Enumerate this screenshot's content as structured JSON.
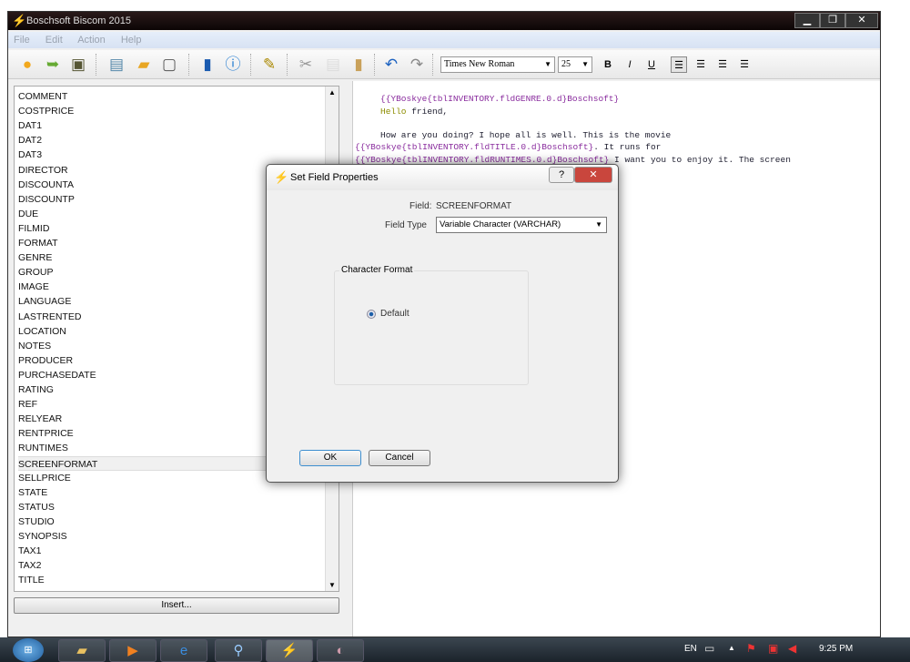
{
  "window": {
    "title": "Boschsoft Biscom 2015",
    "minimize": "▁",
    "maximize": "❐",
    "close": "✕"
  },
  "menu": [
    "File",
    "Edit",
    "Action",
    "Help"
  ],
  "toolbar": {
    "font": "Times New Roman",
    "size": "25",
    "bold": "B",
    "italic": "I",
    "underline": "U",
    "icons": [
      "database-icon",
      "open-folder-icon",
      "save-disk-icon",
      "document-icon",
      "export-folder-icon",
      "save-icon",
      "help-book-icon",
      "info-icon",
      "edit-form-icon",
      "cut-icon",
      "copy-icon",
      "paste-icon",
      "undo-icon",
      "redo-icon"
    ],
    "align_icons": [
      "align-left-icon",
      "align-center-icon",
      "align-right-icon",
      "justify-icon"
    ]
  },
  "fields": [
    "COMMENT",
    "COSTPRICE",
    "DAT1",
    "DAT2",
    "DAT3",
    "DIRECTOR",
    "DISCOUNTA",
    "DISCOUNTP",
    "DUE",
    "FILMID",
    "FORMAT",
    "GENRE",
    "GROUP",
    "IMAGE",
    "LANGUAGE",
    "LASTRENTED",
    "LOCATION",
    "NOTES",
    "PRODUCER",
    "PURCHASEDATE",
    "RATING",
    "REF",
    "RELYEAR",
    "RENTPRICE",
    "RUNTIMES",
    "SCREENFORMAT",
    "SELLPRICE",
    "STATE",
    "STATUS",
    "STUDIO",
    "SYNOPSIS",
    "TAX1",
    "TAX2",
    "TITLE"
  ],
  "selected_field": "SCREENFORMAT",
  "insert_label": "Insert...",
  "editor": {
    "line1": "{{YBoskye{tblINVENTORY.fldGENRE.0.d}Boschsoft}",
    "line2_a": "Hello",
    "line2_b": " friend,",
    "line3": "How are you doing? I hope all is well. This is the movie",
    "line4_a": "{{YBoskye{tblINVENTORY.fldTITLE.0.d}Boschsoft}",
    "line4_b": ". It runs for",
    "line5_a": "{{YBoskye{tblINVENTORY.fldRUNTIMES.0.d}Boschsoft}",
    "line5_b": " I want you to enjoy it. The screen"
  },
  "dialog": {
    "title": "Set Field Properties",
    "help": "?",
    "close": "✕",
    "field_label": "Field:",
    "field_value": "SCREENFORMAT",
    "type_label": "Field Type",
    "type_value": "Variable Character (VARCHAR)",
    "group_label": "Character Format",
    "radio_label": "Default",
    "ok": "OK",
    "cancel": "Cancel"
  },
  "tray": {
    "lang": "EN",
    "time": "9:25 PM"
  },
  "taskbar_icons": [
    "start-orb-icon",
    "file-explorer-icon",
    "media-player-icon",
    "internet-explorer-icon",
    "network-tool-icon",
    "boschsoft-biscom-icon",
    "paint-icon"
  ]
}
